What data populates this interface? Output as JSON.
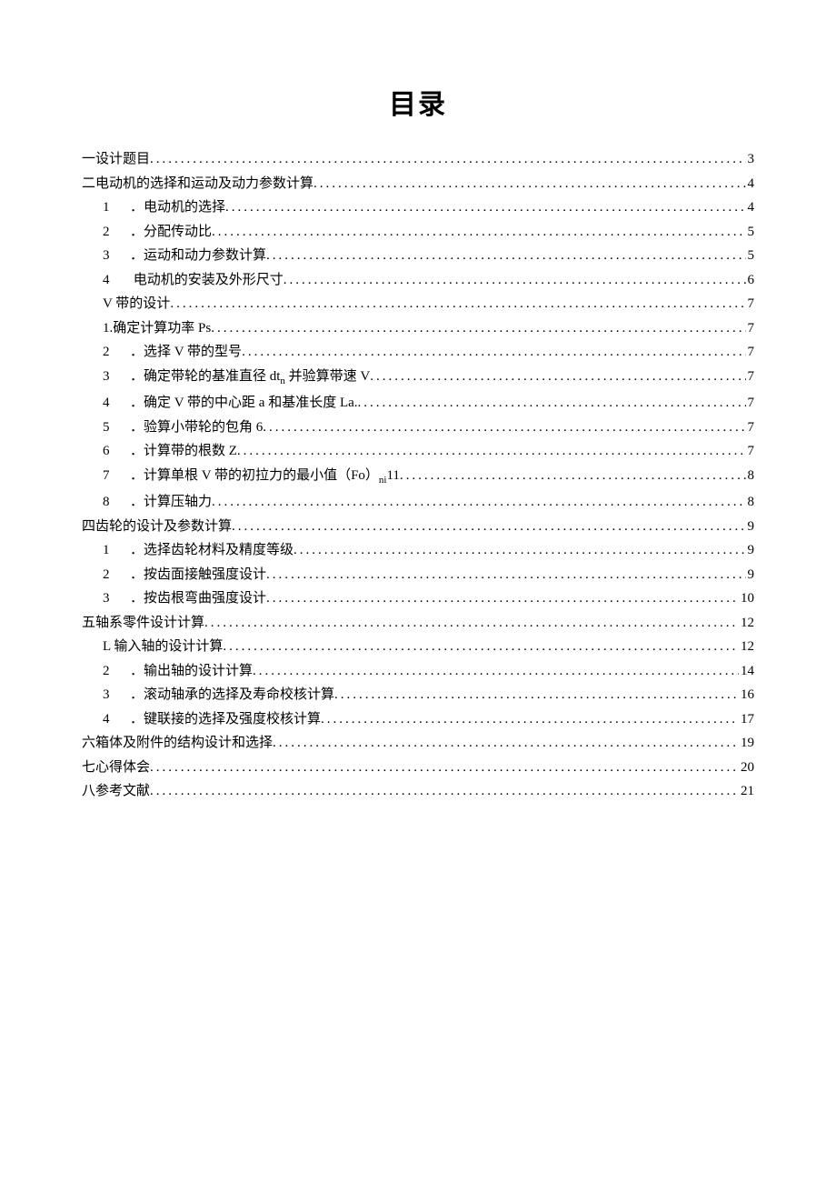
{
  "title": "目录",
  "entries": [
    {
      "indent": 0,
      "text": "一设计题目 ",
      "page": "3"
    },
    {
      "indent": 0,
      "text": "二电动机的选择和运动及动力参数计算 ",
      "page": "4"
    },
    {
      "indent": 2,
      "num": "1",
      "text": "．电动机的选择",
      "page": "4"
    },
    {
      "indent": 2,
      "num": "2",
      "text": "．分配传动比 ",
      "page": "5"
    },
    {
      "indent": 2,
      "num": "3",
      "text": "．运动和动力参数计算 ",
      "page": "5"
    },
    {
      "indent": 2,
      "num": "4",
      "text": " 电动机的安装及外形尺寸 ",
      "page": "6"
    },
    {
      "indent": 1,
      "text": "V 带的设计",
      "page": "7"
    },
    {
      "indent": 1,
      "text": "1.确定计算功率 Ps",
      "page": "7"
    },
    {
      "indent": 2,
      "num": "2",
      "text": "．选择 V 带的型号",
      "page": "7"
    },
    {
      "indent": 2,
      "num": "3",
      "text": "．确定带轮的基准直径 dt",
      "sub": "n",
      "tail": " 并验算带速 V",
      "page": "7"
    },
    {
      "indent": 2,
      "num": "4",
      "text": "．确定 V 带的中心距 a 和基准长度 La.",
      "page": "7"
    },
    {
      "indent": 2,
      "num": "5",
      "text": "．验算小带轮的包角 6",
      "page": "7"
    },
    {
      "indent": 2,
      "num": "6",
      "text": "．计算带的根数 Z",
      "page": "7"
    },
    {
      "indent": 2,
      "num": "7",
      "text": "．计算单根 V 带的初拉力的最小值（Fo）",
      "sub": "ni",
      "tail": "11 ",
      "page": "8"
    },
    {
      "indent": 2,
      "num": "8",
      "text": "．计算压轴力 ",
      "page": "8"
    },
    {
      "indent": 0,
      "text": "四齿轮的设计及参数计算 ",
      "page": "9"
    },
    {
      "indent": 2,
      "num": "1",
      "text": "．选择齿轮材料及精度等级 ",
      "page": "9"
    },
    {
      "indent": 2,
      "num": "2",
      "text": "．按齿面接触强度设计",
      "page": "9"
    },
    {
      "indent": 2,
      "num": "3",
      "text": "．按齿根弯曲强度设计",
      "page": "10"
    },
    {
      "indent": 0,
      "text": "五轴系零件设计计算 ",
      "page": "12"
    },
    {
      "indent": 1,
      "text": "L 输入轴的设计计算",
      "page": "12"
    },
    {
      "indent": 2,
      "num": "2",
      "text": "．输出轴的设计计算",
      "page": "14"
    },
    {
      "indent": 2,
      "num": "3",
      "text": "．滚动轴承的选择及寿命校核计算",
      "page": "16"
    },
    {
      "indent": 2,
      "num": "4",
      "text": "．键联接的选择及强度校核计算",
      "page": "17"
    },
    {
      "indent": 0,
      "text": "六箱体及附件的结构设计和选择 ",
      "page": "19"
    },
    {
      "indent": 0,
      "text": "七心得体会 ",
      "page": "20"
    },
    {
      "indent": 0,
      "text": "八参考文献 ",
      "page": "21"
    }
  ]
}
